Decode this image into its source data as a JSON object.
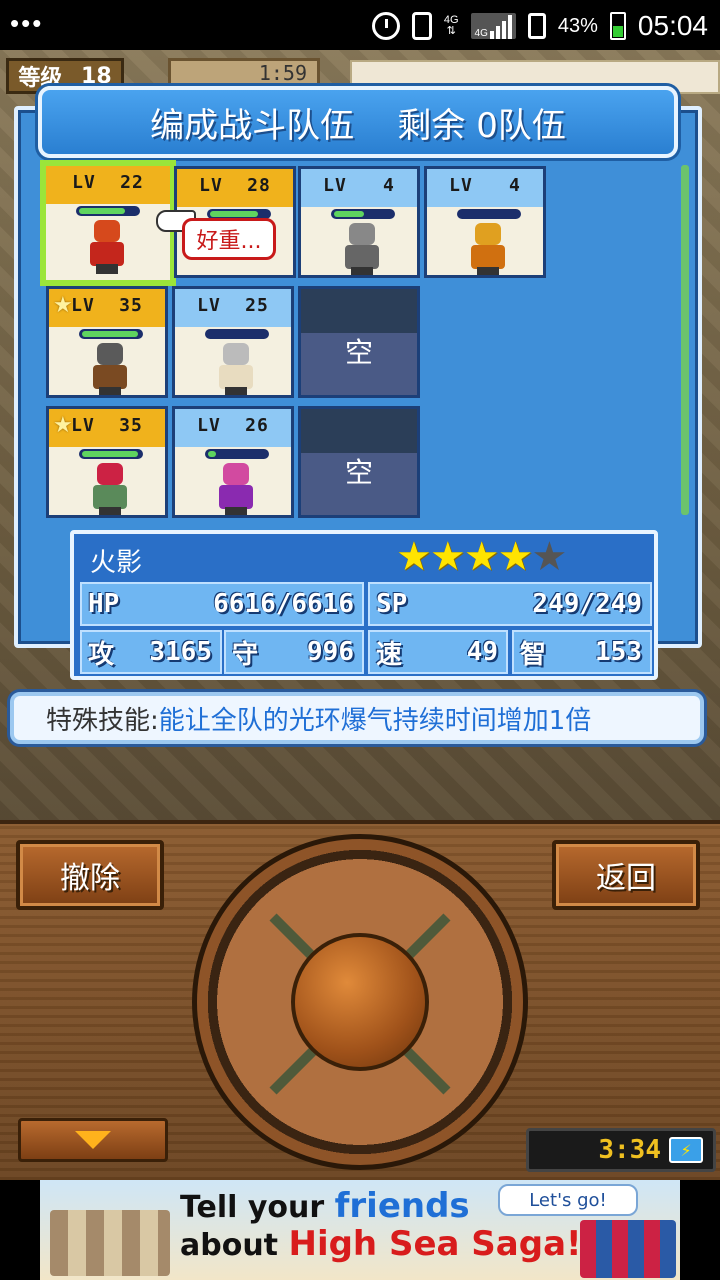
{
  "statusbar": {
    "network": "4G",
    "network_small": "4G",
    "battery": "43%",
    "time": "05:04"
  },
  "hud": {
    "level_label": "等级",
    "level_value": "18",
    "timer": "1:59"
  },
  "dialog": {
    "title_left": "编成战斗队伍",
    "title_right": "剩余 0队伍"
  },
  "units": [
    {
      "lv": "22",
      "hp_pct": 80,
      "selected": true
    },
    {
      "lv": "28",
      "hp_pct": 85
    },
    {
      "lv": "4",
      "hp_pct": 55
    },
    {
      "lv": "4",
      "hp_pct": 0
    },
    {
      "lv": "35",
      "hp_pct": 95,
      "star": true
    },
    {
      "lv": "25",
      "hp_pct": 0
    },
    {
      "empty_label": "空"
    },
    {
      "lv": "35",
      "hp_pct": 95,
      "star": true
    },
    {
      "lv": "26",
      "hp_pct": 10
    },
    {
      "empty_label": "空"
    }
  ],
  "lv_prefix": "LV",
  "bubble": "好重...",
  "character": {
    "name": "火影",
    "stars_filled": 4,
    "stars_total": 5,
    "hp_label": "HP",
    "hp_value": "6616/6616",
    "sp_label": "SP",
    "sp_value": "249/249",
    "atk_label": "攻",
    "atk_value": "3165",
    "def_label": "守",
    "def_value": "996",
    "spd_label": "速",
    "spd_value": "49",
    "int_label": "智",
    "int_value": "153"
  },
  "skill": {
    "label": "特殊技能:",
    "value": "能让全队的光环爆气持续时间增加1倍"
  },
  "buttons": {
    "remove": "撤除",
    "back": "返回"
  },
  "clock": "3:34",
  "ad": {
    "line1_a": "Tell your ",
    "line1_b": "friends",
    "line2_a": "about ",
    "line2_b": "High Sea Saga!",
    "cta": "Let's go!"
  },
  "colors": {
    "panel_blue": "#3f8fd8",
    "gold_band": "#f0b21c",
    "select_green": "#9be53a",
    "skill_value": "#1f6fd6"
  }
}
